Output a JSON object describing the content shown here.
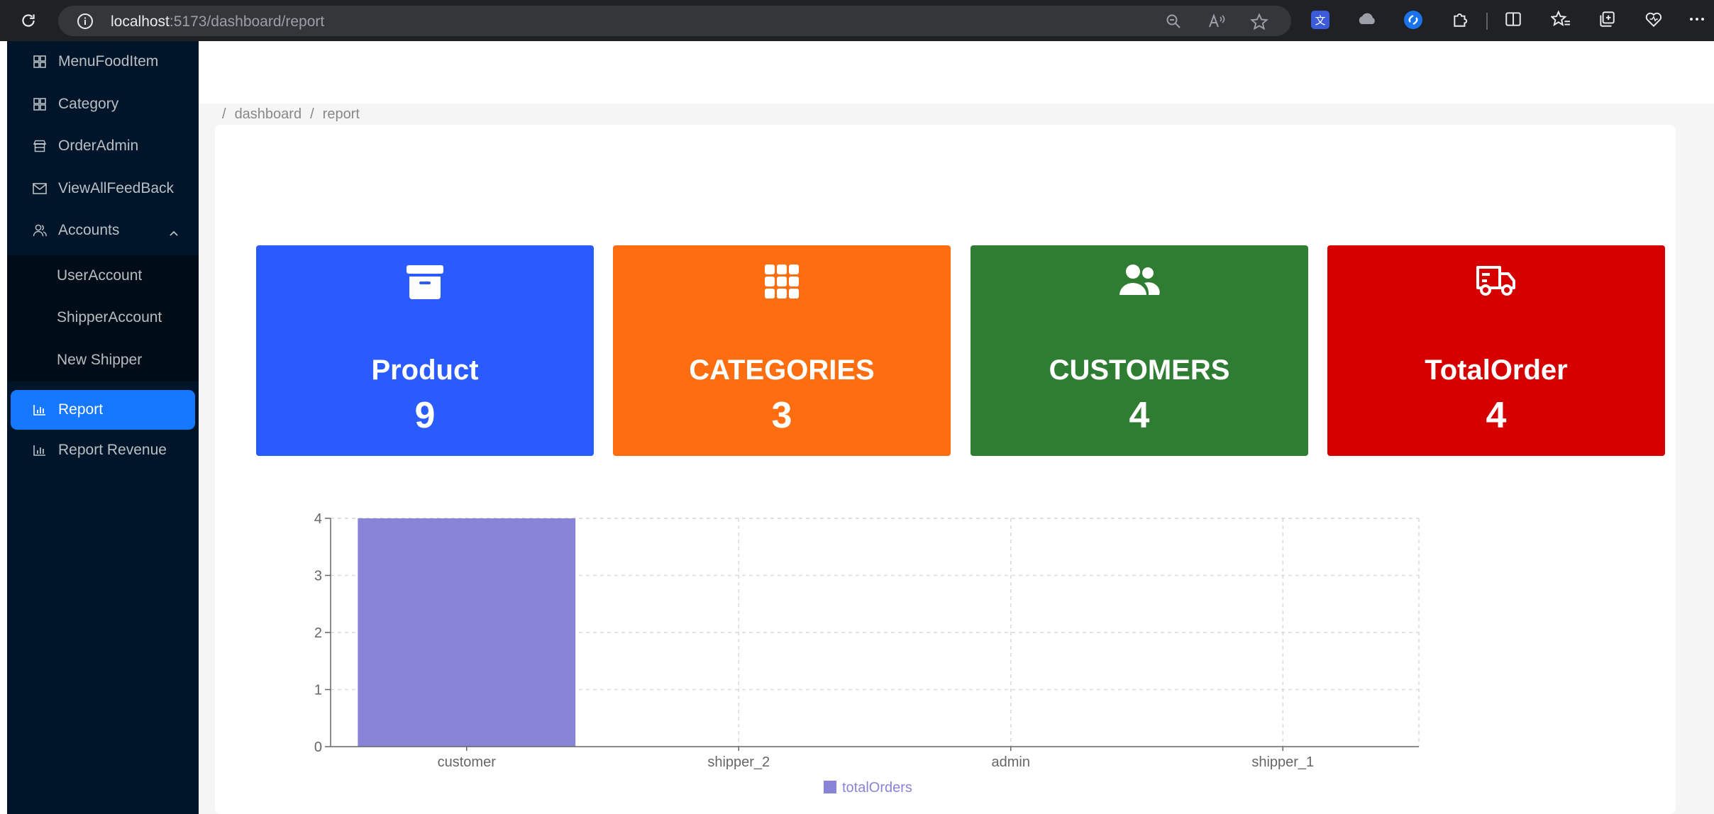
{
  "browser": {
    "url_host": "localhost",
    "url_path": ":5173/dashboard/report"
  },
  "sidebar": {
    "items": [
      {
        "label": "MenuFoodItem",
        "icon": "menu-grid-icon"
      },
      {
        "label": "Category",
        "icon": "category-grid-icon"
      },
      {
        "label": "OrderAdmin",
        "icon": "shop-icon"
      },
      {
        "label": "ViewAllFeedBack",
        "icon": "mail-icon"
      },
      {
        "label": "Accounts",
        "icon": "users-icon"
      }
    ],
    "subitems": [
      {
        "label": "UserAccount"
      },
      {
        "label": "ShipperAccount"
      },
      {
        "label": "New Shipper"
      }
    ],
    "bottom_items": [
      {
        "label": "Report",
        "icon": "bar-chart-icon"
      },
      {
        "label": "Report Revenue",
        "icon": "bar-chart-icon"
      }
    ]
  },
  "breadcrumb": {
    "items": [
      "dashboard",
      "report"
    ]
  },
  "stats": [
    {
      "title": "Product",
      "value": "9",
      "color": "#2a5bff",
      "icon": "archive-box-icon"
    },
    {
      "title": "CATEGORIES",
      "value": "3",
      "color": "#fe6e11",
      "icon": "grid-apps-icon"
    },
    {
      "title": "CUSTOMERS",
      "value": "4",
      "color": "#2e7d32",
      "icon": "people-icon"
    },
    {
      "title": "TotalOrder",
      "value": "4",
      "color": "#d50000",
      "icon": "delivery-truck-icon"
    }
  ],
  "chart_data": {
    "type": "bar",
    "categories": [
      "customer",
      "shipper_2",
      "admin",
      "shipper_1"
    ],
    "series": [
      {
        "name": "totalOrders",
        "values": [
          4,
          0,
          0,
          0
        ],
        "color": "#8884d8"
      }
    ],
    "ylim": [
      0,
      4
    ],
    "yticks": [
      0,
      1,
      2,
      3,
      4
    ],
    "grid": true,
    "legend": "bottom"
  }
}
